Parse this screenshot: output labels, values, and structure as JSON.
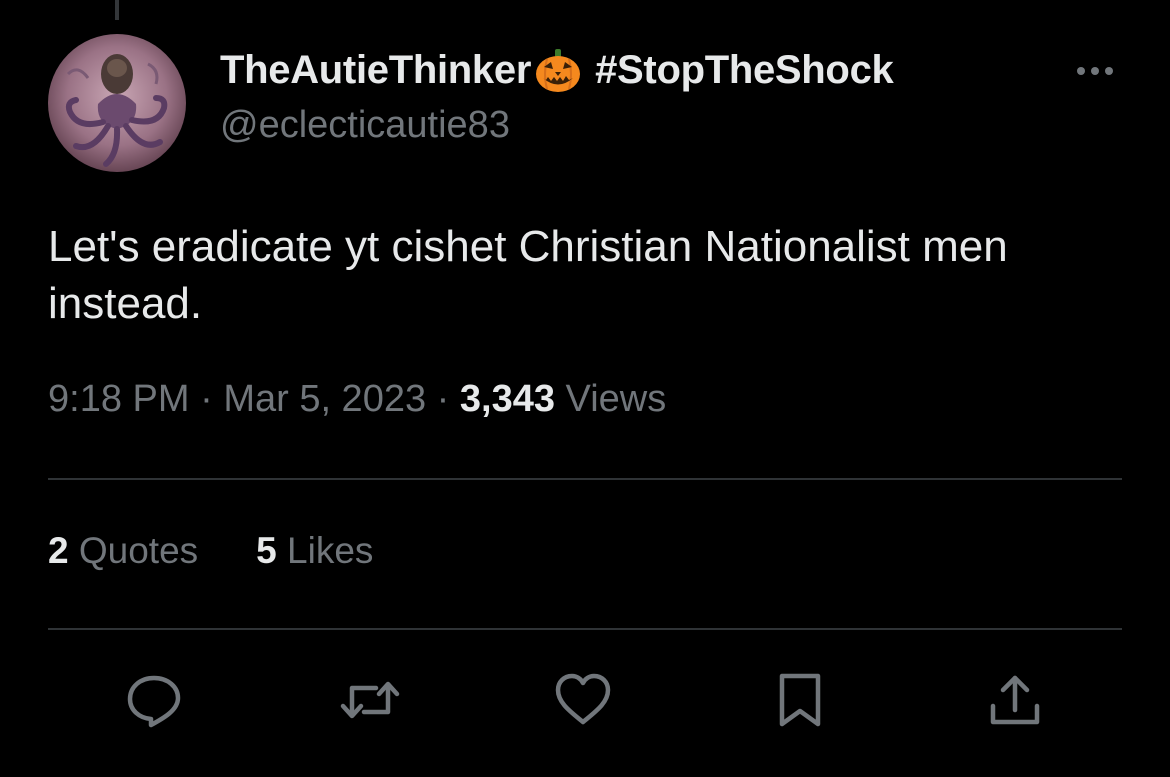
{
  "tweet": {
    "display_name": "TheAutieThinker",
    "name_emoji": "jack-o-lantern-icon",
    "name_hashtag": "#StopTheShock",
    "handle": "@eclecticautie83",
    "text": "Let's eradicate yt cishet Christian Nationalist men instead.",
    "time": "9:18 PM",
    "date": "Mar 5, 2023",
    "separator": "·",
    "views_count": "3,343",
    "views_label": "Views",
    "quotes_count": "2",
    "quotes_label": "Quotes",
    "likes_count": "5",
    "likes_label": "Likes"
  },
  "icons": {
    "more": "more-horizontal-icon",
    "reply": "reply-icon",
    "retweet": "retweet-icon",
    "like": "heart-icon",
    "bookmark": "bookmark-icon",
    "share": "share-icon"
  },
  "colors": {
    "background": "#000000",
    "text_primary": "#e7e9ea",
    "text_secondary": "#71767b",
    "divider": "#2f3336",
    "pumpkin": "#f5891e"
  }
}
